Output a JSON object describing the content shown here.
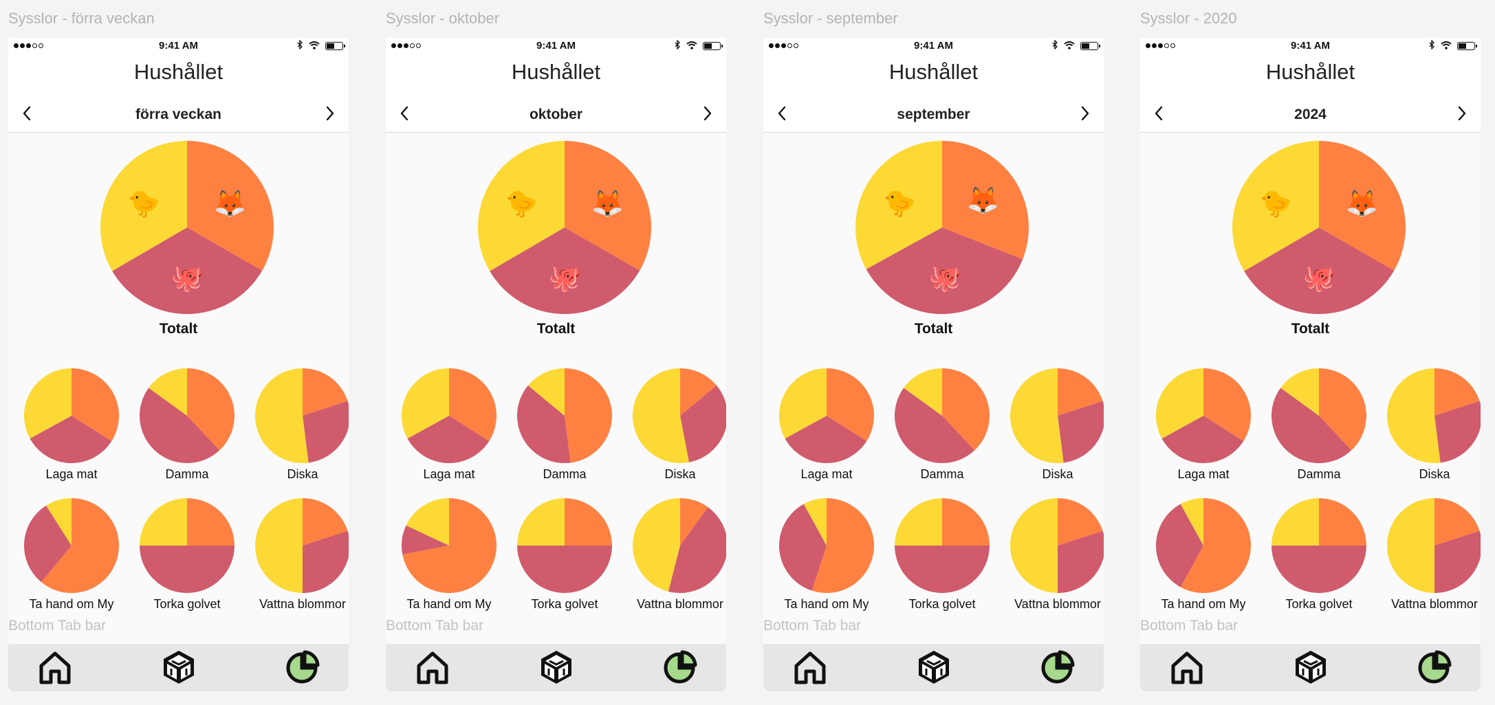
{
  "colors": {
    "fox": "#ff8142",
    "chick": "#fcd935",
    "octopus": "#cf5b6c",
    "tab_active_fill": "#a6d98c",
    "tab_icon": "#111111"
  },
  "status_bar": {
    "time": "9:41 AM"
  },
  "app_title": "Hushållet",
  "total_label": "Totalt",
  "tabbar_label": "Bottom Tab bar",
  "emoji": {
    "fox": "🦊",
    "chick": "🐤",
    "octopus": "🐙"
  },
  "icons": {
    "prev": "chevron-left-icon",
    "next": "chevron-right-icon",
    "home": "home-icon",
    "cube": "cube-icon",
    "stats": "pie-chart-icon"
  },
  "screens": [
    {
      "frame_title": "Sysslor - förra veckan",
      "period": "förra veckan",
      "total": [
        0.333,
        0.333,
        0.334
      ],
      "chores": [
        {
          "label": "Laga mat",
          "shares": [
            0.34,
            0.33,
            0.33
          ]
        },
        {
          "label": "Damma",
          "shares": [
            0.38,
            0.47,
            0.15
          ]
        },
        {
          "label": "Diska",
          "shares": [
            0.2,
            0.28,
            0.52
          ]
        },
        {
          "label": "Ta hand om My",
          "shares": [
            0.61,
            0.3,
            0.09
          ]
        },
        {
          "label": "Torka golvet",
          "shares": [
            0.25,
            0.5,
            0.25
          ]
        },
        {
          "label": "Vattna blommor",
          "shares": [
            0.2,
            0.3,
            0.5
          ]
        }
      ]
    },
    {
      "frame_title": "Sysslor - oktober",
      "period": "oktober",
      "total": [
        0.333,
        0.333,
        0.334
      ],
      "chores": [
        {
          "label": "Laga mat",
          "shares": [
            0.34,
            0.33,
            0.33
          ]
        },
        {
          "label": "Damma",
          "shares": [
            0.48,
            0.38,
            0.14
          ]
        },
        {
          "label": "Diska",
          "shares": [
            0.14,
            0.33,
            0.53
          ]
        },
        {
          "label": "Ta hand om My",
          "shares": [
            0.72,
            0.1,
            0.18
          ]
        },
        {
          "label": "Torka golvet",
          "shares": [
            0.25,
            0.5,
            0.25
          ]
        },
        {
          "label": "Vattna blommor",
          "shares": [
            0.1,
            0.44,
            0.46
          ]
        }
      ]
    },
    {
      "frame_title": "Sysslor - september",
      "period": "september",
      "total": [
        0.31,
        0.36,
        0.33
      ],
      "chores": [
        {
          "label": "Laga mat",
          "shares": [
            0.34,
            0.33,
            0.33
          ]
        },
        {
          "label": "Damma",
          "shares": [
            0.38,
            0.47,
            0.15
          ]
        },
        {
          "label": "Diska",
          "shares": [
            0.2,
            0.28,
            0.52
          ]
        },
        {
          "label": "Ta hand om My",
          "shares": [
            0.55,
            0.37,
            0.08
          ]
        },
        {
          "label": "Torka golvet",
          "shares": [
            0.25,
            0.5,
            0.25
          ]
        },
        {
          "label": "Vattna blommor",
          "shares": [
            0.2,
            0.3,
            0.5
          ]
        }
      ]
    },
    {
      "frame_title": "Sysslor - 2020",
      "period": "2024",
      "total": [
        0.333,
        0.333,
        0.334
      ],
      "chores": [
        {
          "label": "Laga mat",
          "shares": [
            0.34,
            0.33,
            0.33
          ]
        },
        {
          "label": "Damma",
          "shares": [
            0.38,
            0.47,
            0.15
          ]
        },
        {
          "label": "Diska",
          "shares": [
            0.2,
            0.28,
            0.52
          ]
        },
        {
          "label": "Ta hand om My",
          "shares": [
            0.58,
            0.34,
            0.08
          ]
        },
        {
          "label": "Torka golvet",
          "shares": [
            0.25,
            0.5,
            0.25
          ]
        },
        {
          "label": "Vattna blommor",
          "shares": [
            0.2,
            0.3,
            0.5
          ]
        }
      ]
    }
  ]
}
